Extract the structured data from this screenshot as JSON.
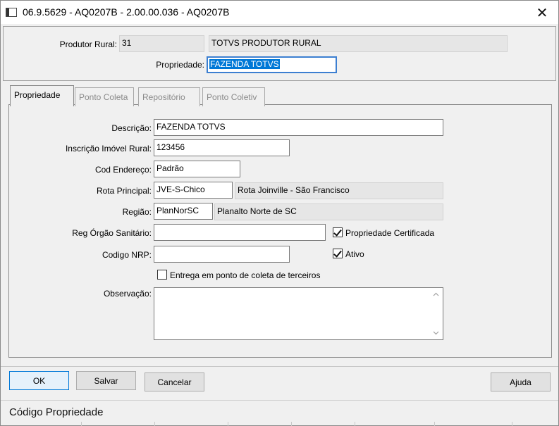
{
  "window": {
    "title": "06.9.5629 - AQ0207B - 2.00.00.036 - AQ0207B",
    "close_glyph": "✕"
  },
  "header": {
    "produtor_label": "Produtor Rural:",
    "produtor_code": "31",
    "produtor_name": "TOTVS PRODUTOR RURAL",
    "propriedade_label": "Propriedade:",
    "propriedade_value": "FAZENDA TOTVS"
  },
  "tabs": [
    {
      "label": "Propriedade",
      "active": true
    },
    {
      "label": "Ponto Coleta",
      "active": false
    },
    {
      "label": "Repositório",
      "active": false
    },
    {
      "label": "Ponto Coletiv",
      "active": false
    }
  ],
  "form": {
    "descricao_label": "Descrição:",
    "descricao_value": "FAZENDA TOTVS",
    "inscricao_label": "Inscrição Imóvel Rural:",
    "inscricao_value": "123456",
    "endereco_label": "Cod Endereço:",
    "endereco_value": "Padrão",
    "rota_label": "Rota Principal:",
    "rota_code": "JVE-S-Chico",
    "rota_name": "Rota Joinville - São Francisco",
    "regiao_label": "Região:",
    "regiao_code": "PlanNorSC",
    "regiao_name": "Planalto Norte de SC",
    "reg_orgao_label": "Reg Órgão Sanitário:",
    "reg_orgao_value": "",
    "propriedade_certificada_label": "Propriedade Certificada",
    "propriedade_certificada_checked": true,
    "codigo_nrp_label": "Codigo NRP:",
    "codigo_nrp_value": "",
    "ativo_label": "Ativo",
    "ativo_checked": true,
    "entrega_label": "Entrega em ponto de coleta de terceiros",
    "entrega_checked": false,
    "observacao_label": "Observação:",
    "observacao_value": ""
  },
  "buttons": {
    "ok": "OK",
    "salvar": "Salvar",
    "cancelar": "Cancelar",
    "ajuda": "Ajuda"
  },
  "status": {
    "text": "Código Propriedade"
  },
  "colors": {
    "selection": "#0078d7",
    "window_bg": "#f0f0f0",
    "readonly_field": "#e6e6e6"
  }
}
